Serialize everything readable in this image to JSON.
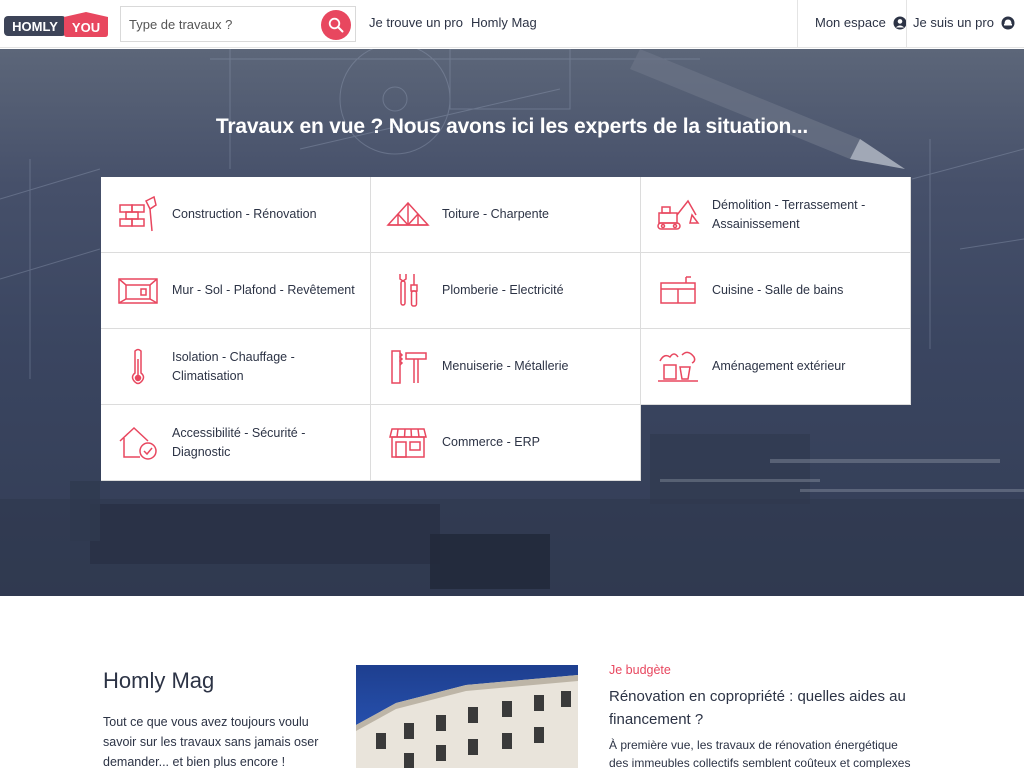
{
  "header": {
    "logo": {
      "left": "HOMLY",
      "right": "YOU"
    },
    "search": {
      "placeholder": "Type de travaux ?"
    },
    "nav": {
      "find_pro": "Je trouve un pro",
      "mag": "Homly Mag",
      "my_space": "Mon espace",
      "i_am_pro": "Je suis un pro"
    }
  },
  "hero": {
    "title": "Travaux en vue ? Nous avons ici les experts de la situation..."
  },
  "categories": [
    {
      "label": "Construction - Rénovation",
      "icon": "bricks-trowel-icon"
    },
    {
      "label": "Toiture - Charpente",
      "icon": "roof-truss-icon"
    },
    {
      "label": "Démolition - Terrassement - Assainissement",
      "icon": "excavator-icon"
    },
    {
      "label": "Mur - Sol - Plafond - Revêtement",
      "icon": "room-walls-icon"
    },
    {
      "label": "Plomberie - Electricité",
      "icon": "wrench-screwdriver-icon"
    },
    {
      "label": "Cuisine - Salle de bains",
      "icon": "kitchen-cabinet-icon"
    },
    {
      "label": "Isolation - Chauffage - Climatisation",
      "icon": "thermometer-icon"
    },
    {
      "label": "Menuiserie - Métallerie",
      "icon": "hammer-saw-icon"
    },
    {
      "label": "Aménagement extérieur",
      "icon": "garden-icon"
    },
    {
      "label": "Accessibilité - Sécurité - Diagnostic",
      "icon": "house-check-icon"
    },
    {
      "label": "Commerce - ERP",
      "icon": "storefront-icon"
    }
  ],
  "mag": {
    "title": "Homly Mag",
    "description": "Tout ce que vous avez toujours voulu savoir sur les travaux sans jamais oser demander... et bien plus encore !",
    "article": {
      "category": "Je budgète",
      "title": "Rénovation en copropriété : quelles aides au financement ?",
      "excerpt": "À première vue, les travaux de rénovation énergétique des immeubles collectifs semblent coûteux et complexes à"
    }
  },
  "colors": {
    "accent": "#e8475f",
    "logo_dark": "#3d4458",
    "text": "#2c3345"
  }
}
